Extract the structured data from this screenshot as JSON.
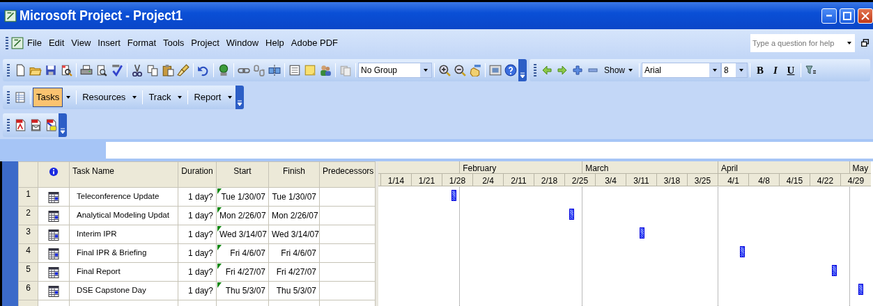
{
  "window": {
    "title": "Microsoft Project - Project1"
  },
  "menu": [
    "File",
    "Edit",
    "View",
    "Insert",
    "Format",
    "Tools",
    "Project",
    "Window",
    "Help",
    "Adobe PDF"
  ],
  "help_box": {
    "placeholder": "Type a question for help"
  },
  "standard_toolbar": {
    "group_select": {
      "value": "No Group"
    }
  },
  "formatting_toolbar": {
    "show_button": "Show",
    "font": {
      "value": "Arial"
    },
    "size": {
      "value": "8"
    },
    "bold": "B",
    "italic": "I",
    "underline": "U"
  },
  "guide_toolbar": {
    "items": [
      {
        "label": "Tasks",
        "selected": true
      },
      {
        "label": "Resources",
        "selected": false
      },
      {
        "label": "Track",
        "selected": false
      },
      {
        "label": "Report",
        "selected": false
      }
    ]
  },
  "table": {
    "columns": [
      "Task Name",
      "Duration",
      "Start",
      "Finish",
      "Predecessors"
    ],
    "rows": [
      {
        "id": "1",
        "name": "Teleconference Update",
        "duration": "1 day?",
        "start": "Tue 1/30/07",
        "finish": "Tue 1/30/07"
      },
      {
        "id": "2",
        "name": "Analytical Modeling Updat",
        "duration": "1 day?",
        "start": "Mon 2/26/07",
        "finish": "Mon 2/26/07"
      },
      {
        "id": "3",
        "name": "Interim IPR",
        "duration": "1 day?",
        "start": "Wed 3/14/07",
        "finish": "Wed 3/14/07"
      },
      {
        "id": "4",
        "name": "Final IPR & Briefing",
        "duration": "1 day?",
        "start": "Fri 4/6/07",
        "finish": "Fri 4/6/07"
      },
      {
        "id": "5",
        "name": "Final Report",
        "duration": "1 day?",
        "start": "Fri 4/27/07",
        "finish": "Fri 4/27/07"
      },
      {
        "id": "6",
        "name": "DSE Capstone Day",
        "duration": "1 day?",
        "start": "Thu 5/3/07",
        "finish": "Thu 5/3/07"
      }
    ]
  },
  "gantt": {
    "months": [
      "February",
      "March",
      "April",
      "May"
    ],
    "weeks": [
      "1/14",
      "1/21",
      "1/28",
      "2/4",
      "2/11",
      "2/18",
      "2/25",
      "3/4",
      "3/11",
      "3/18",
      "3/25",
      "4/1",
      "4/8",
      "4/15",
      "4/22",
      "4/29"
    ]
  }
}
